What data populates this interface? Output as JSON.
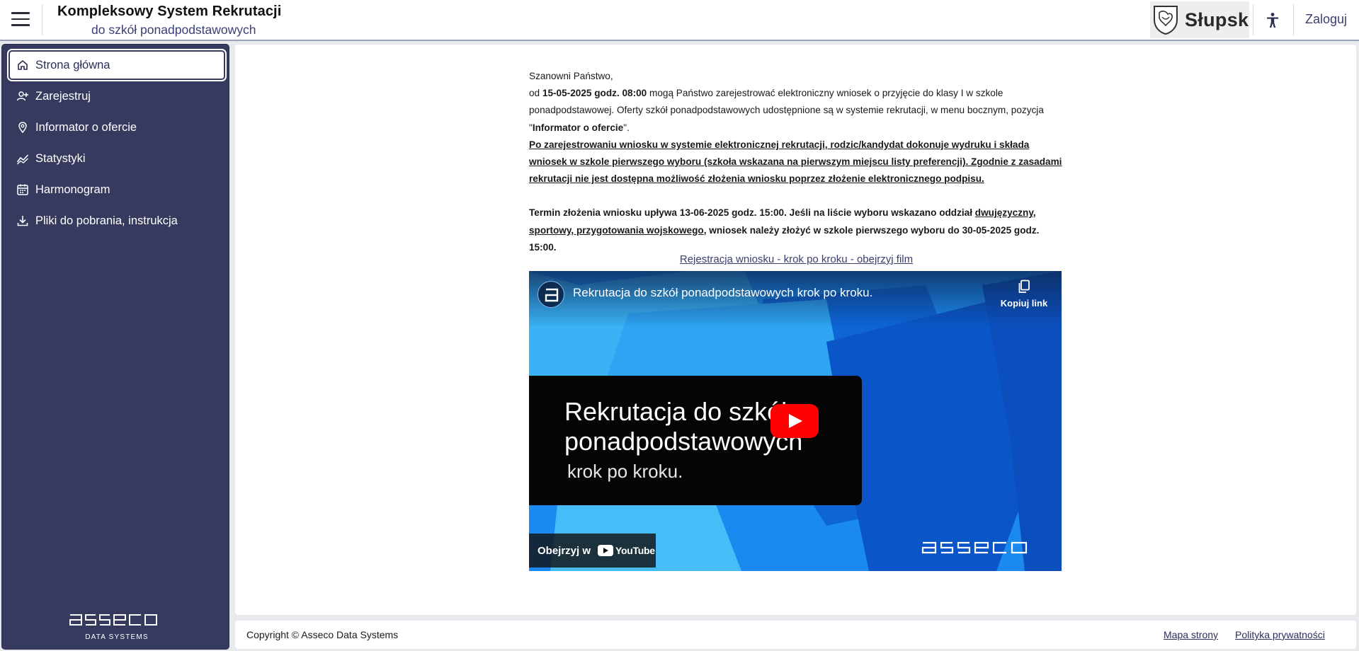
{
  "header": {
    "title": "Kompleksowy System Rekrutacji",
    "subtitle": "do szkół ponadpodstawowych",
    "city": "Słupsk",
    "login": "Zaloguj"
  },
  "sidebar": {
    "items": [
      {
        "label": "Strona główna",
        "icon": "home-icon"
      },
      {
        "label": "Zarejestruj",
        "icon": "user-plus-icon"
      },
      {
        "label": "Informator o ofercie",
        "icon": "map-pin-icon"
      },
      {
        "label": "Statystyki",
        "icon": "stats-icon"
      },
      {
        "label": "Harmonogram",
        "icon": "calendar-icon"
      },
      {
        "label": "Pliki do pobrania, instrukcja",
        "icon": "download-icon"
      }
    ],
    "logo_sub": "DATA SYSTEMS"
  },
  "content": {
    "greeting": "Szanowni Państwo,",
    "p1_pre": "od ",
    "p1_date": "15-05-2025 godz. 08:00",
    "p1_rest": " mogą Państwo zarejestrować elektroniczny wniosek o przyjęcie do klasy I w szkole ponadpodstawowej. Oferty szkół ponadpodstawowych udostępnione są w systemie rekrutacji, w menu bocznym, pozycja \"",
    "p1_link": "Informator o ofercie",
    "p1_end": "\".",
    "p2": "Po zarejestrowaniu wniosku w systemie elektronicznej rekrutacji, rodzic/kandydat dokonuje wydruku i składa wniosek w szkole pierwszego wyboru (szkoła wskazana na pierwszym miejscu listy preferencji). Zgodnie z zasadami rekrutacji nie jest dostępna możliwość złożenia wniosku poprzez złożenie elektronicznego podpisu.",
    "p3_a": "Termin złożenia wniosku upływa 13-06-2025 godz. 15:00. Jeśli na liście wyboru wskazano oddział ",
    "p3_u1": "dwujęzyczny",
    "p3_b": ", ",
    "p3_u2": "sportowy, przygotowania wojskowego",
    "p3_c": ", wniosek należy złożyć w szkole pierwszego wyboru do 30-05-2025 godz. 15:00.",
    "film_link": "Rejestracja wniosku - krok po kroku - obejrzyj film"
  },
  "video": {
    "title": "Rekrutacja do szkół ponadpodstawowych krok po kroku.",
    "copy_link": "Kopiuj link",
    "card_line1": "Rekrutacja do szkół",
    "card_line2": "ponadpodstawowych",
    "card_line3": "krok po kroku.",
    "watch_on": "Obejrzyj w",
    "youtube": "YouTube"
  },
  "footer": {
    "copyright": "Copyright © Asseco Data Systems",
    "sitemap": "Mapa strony",
    "privacy": "Polityka prywatności"
  }
}
